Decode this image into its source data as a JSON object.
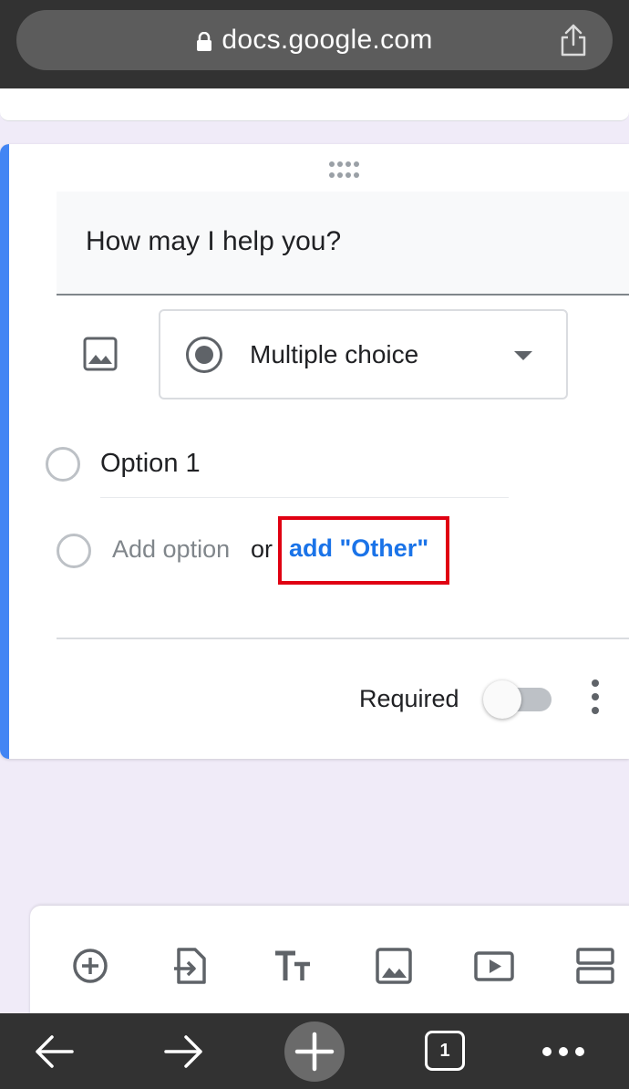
{
  "browser": {
    "url": "docs.google.com",
    "tab_count": "1"
  },
  "question": {
    "title": "How may I help you?",
    "type_label": "Multiple choice",
    "options": [
      "Option 1"
    ],
    "add_option": "Add option",
    "or_text": "or",
    "add_other": "add \"Other\"",
    "required_label": "Required",
    "required_on": false
  },
  "colors": {
    "accent": "#4285f4",
    "link": "#1a73e8",
    "highlight": "#e00012"
  },
  "icons": {
    "toolbar": [
      "add-question-icon",
      "import-questions-icon",
      "add-title-icon",
      "add-image-icon",
      "add-video-icon",
      "add-section-icon"
    ],
    "browser_nav": [
      "back-icon",
      "forward-icon",
      "new-tab-icon",
      "tabs-icon",
      "more-icon"
    ]
  }
}
